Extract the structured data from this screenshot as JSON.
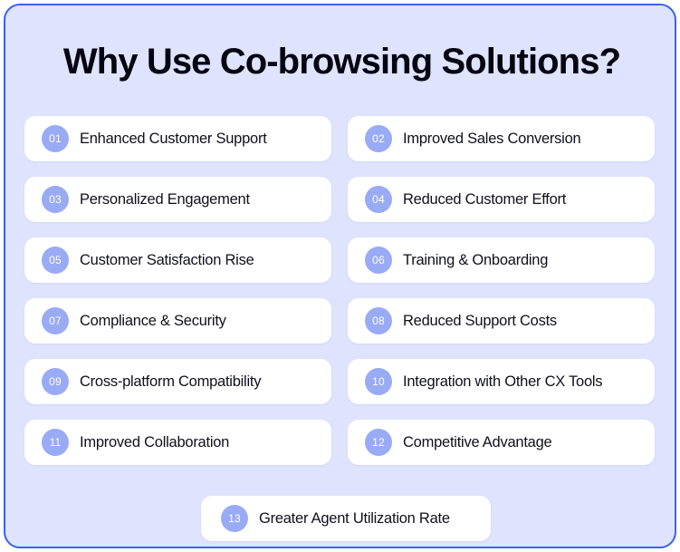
{
  "panel": {
    "title": "Why Use Co-browsing Solutions?",
    "background_color": "#dfe3fd",
    "border_color": "#3a62f0",
    "card_color": "#ffffff",
    "badge_color": "#9aabf5",
    "title_color": "#050510"
  },
  "benefits": [
    {
      "number": "01",
      "label": "Enhanced Customer Support"
    },
    {
      "number": "02",
      "label": "Improved Sales Conversion"
    },
    {
      "number": "03",
      "label": "Personalized Engagement"
    },
    {
      "number": "04",
      "label": "Reduced Customer Effort"
    },
    {
      "number": "05",
      "label": "Customer Satisfaction Rise"
    },
    {
      "number": "06",
      "label": "Training & Onboarding"
    },
    {
      "number": "07",
      "label": "Compliance & Security"
    },
    {
      "number": "08",
      "label": "Reduced Support Costs"
    },
    {
      "number": "09",
      "label": "Cross-platform Compatibility"
    },
    {
      "number": "10",
      "label": "Integration with Other CX Tools"
    },
    {
      "number": "11",
      "label": "Improved Collaboration"
    },
    {
      "number": "12",
      "label": "Competitive Advantage"
    },
    {
      "number": "13",
      "label": "Greater Agent Utilization Rate"
    }
  ]
}
